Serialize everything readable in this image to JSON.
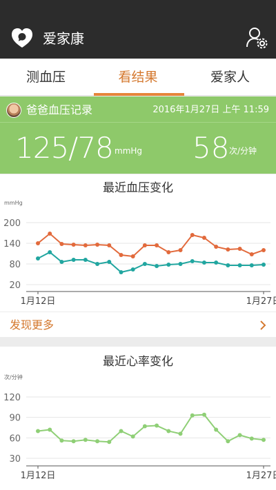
{
  "app": {
    "title": "爱家康"
  },
  "tabs": [
    {
      "label": "测血压",
      "active": false
    },
    {
      "label": "看结果",
      "active": true
    },
    {
      "label": "爱家人",
      "active": false
    }
  ],
  "record": {
    "title": "爸爸血压记录",
    "datetime": "2016年1月27日 上午 11:59",
    "bp_value": "125/78",
    "bp_unit": "mmHg",
    "hr_value": "58",
    "hr_unit": "次/分钟"
  },
  "more_link": {
    "label": "发现更多"
  },
  "colors": {
    "header_bg": "#2c2c2c",
    "accent_orange": "#e5853a",
    "summary_green": "#8ec96a",
    "systolic": "#e26a3c",
    "diastolic": "#21a6a0",
    "heart_rate": "#8fcf76"
  },
  "icons": {
    "logo": "heart-chat-logo-icon",
    "profile": "user-settings-icon",
    "more": "chevron-right-icon"
  },
  "chart_data": [
    {
      "type": "line",
      "title": "最近血压变化",
      "ylabel": "mmHg",
      "y_ticks": [
        200,
        140,
        80,
        20
      ],
      "ylim": [
        20,
        200
      ],
      "x_tick_labels": [
        "1月12日",
        "1月27日"
      ],
      "grid": true,
      "series": [
        {
          "name": "systolic",
          "values": [
            140,
            168,
            138,
            136,
            134,
            136,
            134,
            106,
            102,
            134,
            134,
            114,
            120,
            164,
            156,
            130,
            122,
            124,
            108,
            120
          ]
        },
        {
          "name": "diastolic",
          "values": [
            96,
            114,
            86,
            92,
            92,
            80,
            86,
            56,
            64,
            80,
            74,
            78,
            80,
            88,
            84,
            84,
            76,
            76,
            76,
            78
          ]
        }
      ]
    },
    {
      "type": "line",
      "title": "最近心率变化",
      "ylabel": "次/分钟",
      "y_ticks": [
        120,
        90,
        60,
        30
      ],
      "ylim": [
        30,
        120
      ],
      "x_tick_labels": [
        "1月12日",
        "1月27日"
      ],
      "grid": true,
      "series": [
        {
          "name": "heart rate",
          "values": [
            70,
            72,
            56,
            55,
            57,
            55,
            54,
            70,
            62,
            77,
            78,
            70,
            66,
            93,
            94,
            72,
            55,
            64,
            59,
            57
          ]
        }
      ]
    }
  ]
}
